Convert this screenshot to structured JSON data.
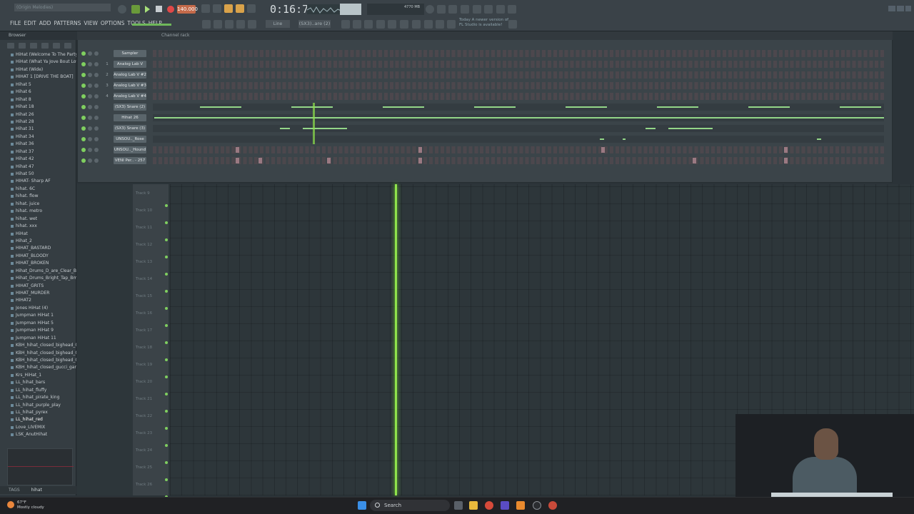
{
  "app": {
    "title_field": "(Origin Melodies)",
    "menu": [
      "FILE",
      "EDIT",
      "ADD",
      "PATTERNS",
      "VIEW",
      "OPTIONS",
      "TOOLS",
      "HELP"
    ],
    "tempo": "140.000",
    "time": "0:16:73",
    "cpu_readout": "4770 MB",
    "pattern_selector": "(SX3)..are (2)",
    "snap_selector": "Line",
    "news": [
      "Today  A newer version of",
      "FL Studio is available!"
    ]
  },
  "browser": {
    "header": "Browser",
    "files": [
      "HiHat (Welcome To The Party)",
      "HiHat (What Ya Jove Bout Love)",
      "HiHat (Wide)",
      "HIHAT 1 [DRIVE THE BOAT]",
      "Hihat 5",
      "Hihat 6",
      "Hihat 8",
      "Hihat 18",
      "Hihat 26",
      "Hihat 28",
      "Hihat 31",
      "Hihat 34",
      "Hihat 36",
      "Hihat 37",
      "Hihat 42",
      "Hihat 47",
      "Hihat 50",
      "HIHAT- Sharp AF",
      "hihat. 6C",
      "hihat. flow",
      "hihat. juice",
      "hihat. metro",
      "hihat. wet",
      "hihat. xxx",
      "HiHat",
      "Hihat_2",
      "HIHAT_BASTARD",
      "HIHAT_BLOODY",
      "HIHAT_BROKEN",
      "Hihat_Drums_D_are_Clear_Bm",
      "Hihat_Drums_Bright_Tap_Bm",
      "HIHAT_GRITS",
      "HIHAT_MURDER",
      "HIHAT2",
      "Jones HiHat (4)",
      "Jumpman HiHat 1",
      "Jumpman HiHat 5",
      "Jumpman HiHat 9",
      "Jumpman HiHat 11",
      "KBH_hihat_closed_bighead_01",
      "KBH_hihat_closed_bighead_05",
      "KBH_hihat_closed_bighead_06",
      "KBH_hihat_closed_gucci_gang",
      "Krs_HiHat_1",
      "LL_hihat_bars",
      "LL_hihat_fluffy",
      "LL_hihat_pirate_king",
      "LL_hihat_purple_play",
      "LL_hihat_pyrex",
      "LL_hihat_red",
      "Love_LIVEMIX",
      "LSK_AnutHihat"
    ],
    "selected_file": "LL_hihat_red",
    "tags_label": "TAGS",
    "search_value": "hihat"
  },
  "channel_rack": {
    "title": "Channel rack",
    "channels": [
      {
        "num": "",
        "name": "Sampler",
        "kind": "steps"
      },
      {
        "num": "1",
        "name": "Analog Lab V",
        "kind": "steps"
      },
      {
        "num": "2",
        "name": "Analog Lab V #2",
        "kind": "steps"
      },
      {
        "num": "3",
        "name": "Analog Lab V #3",
        "kind": "steps"
      },
      {
        "num": "4",
        "name": "Analog Lab V #4",
        "kind": "steps"
      },
      {
        "num": "",
        "name": "(SX3) Snare (2)",
        "kind": "roll"
      },
      {
        "num": "",
        "name": "Hihat 26",
        "kind": "roll"
      },
      {
        "num": "",
        "name": "(SX3) Snare (3)",
        "kind": "roll"
      },
      {
        "num": "",
        "name": "UNSOU.._Rose",
        "kind": "roll"
      },
      {
        "num": "",
        "name": "UNSOU.._Hound",
        "kind": "steps"
      },
      {
        "num": "",
        "name": "VENI Per.. - 257",
        "kind": "steps"
      }
    ]
  },
  "playlist": {
    "tracks": [
      "Track 9",
      "Track 10",
      "Track 11",
      "Track 12",
      "Track 13",
      "Track 14",
      "Track 15",
      "Track 16",
      "Track 17",
      "Track 18",
      "Track 19",
      "Track 20",
      "Track 21",
      "Track 22",
      "Track 23",
      "Track 24",
      "Track 25",
      "Track 26"
    ]
  },
  "taskbar": {
    "weather_temp": "67°F",
    "weather_desc": "Mostly cloudy",
    "search_label": "Search"
  },
  "colors": {
    "accent_green": "#8fe34c",
    "record_red": "#e04848",
    "tempo_orange": "#c46a4a"
  }
}
